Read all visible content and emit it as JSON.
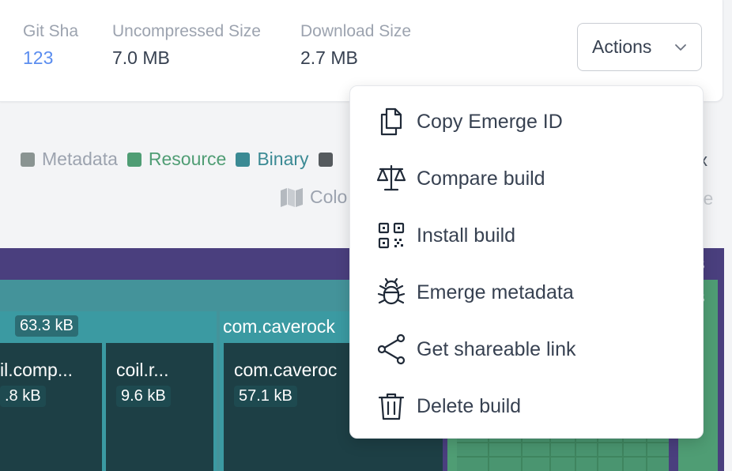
{
  "stats": {
    "git_sha": {
      "label": "Git Sha",
      "value": "123"
    },
    "uncompressed": {
      "label": "Uncompressed Size",
      "value": "7.0 MB"
    },
    "download": {
      "label": "Download Size",
      "value": "2.7 MB"
    }
  },
  "actions": {
    "label": "Actions"
  },
  "legend": {
    "items": [
      {
        "label": "Metadata",
        "color": "#8a9492",
        "text_color": "#9ca3af"
      },
      {
        "label": "Resource",
        "color": "#4f9d74",
        "text_color": "#4f9d74"
      },
      {
        "label": "Binary",
        "color": "#3b8a94",
        "text_color": "#3b8a94"
      },
      {
        "label": "",
        "color": "#555a5e",
        "text_color": "#555a5e"
      }
    ],
    "partial_right": "x",
    "color_toggle": "Colo",
    "partial_right2": "ve"
  },
  "treemap": {
    "top_partial": "s",
    "right_partial": "s",
    "size_63": "63.3 kB",
    "group_label": "com.caverock",
    "cell1": {
      "name": "il.comp...",
      "size": ".8 kB"
    },
    "cell2": {
      "name": "coil.r...",
      "size": "9.6 kB"
    },
    "cell3": {
      "name": "com.caveroc",
      "size": "57.1 kB"
    }
  },
  "menu": {
    "items": [
      {
        "label": "Copy Emerge ID",
        "icon": "copy-icon"
      },
      {
        "label": "Compare build",
        "icon": "scale-icon"
      },
      {
        "label": "Install build",
        "icon": "qr-code-icon"
      },
      {
        "label": "Emerge metadata",
        "icon": "bug-icon"
      },
      {
        "label": "Get shareable link",
        "icon": "share-icon"
      },
      {
        "label": "Delete build",
        "icon": "trash-icon"
      }
    ]
  }
}
